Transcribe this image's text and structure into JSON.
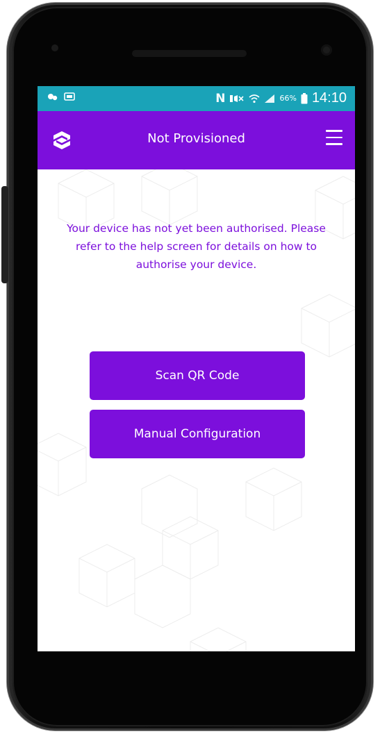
{
  "status_bar": {
    "left_icons": [
      "cast-icon",
      "image-icon"
    ],
    "network_letter": "N",
    "battery_pct": "66%",
    "time": "14:10"
  },
  "app_bar": {
    "title": "Not Provisioned"
  },
  "main": {
    "message": "Your device has not yet been authorised. Please refer to the help screen for details on how to authorise your device.",
    "scan_button_label": "Scan QR Code",
    "manual_button_label": "Manual Configuration"
  },
  "colors": {
    "accent": "#7c0fdc",
    "status_bar": "#1aa3b8"
  }
}
